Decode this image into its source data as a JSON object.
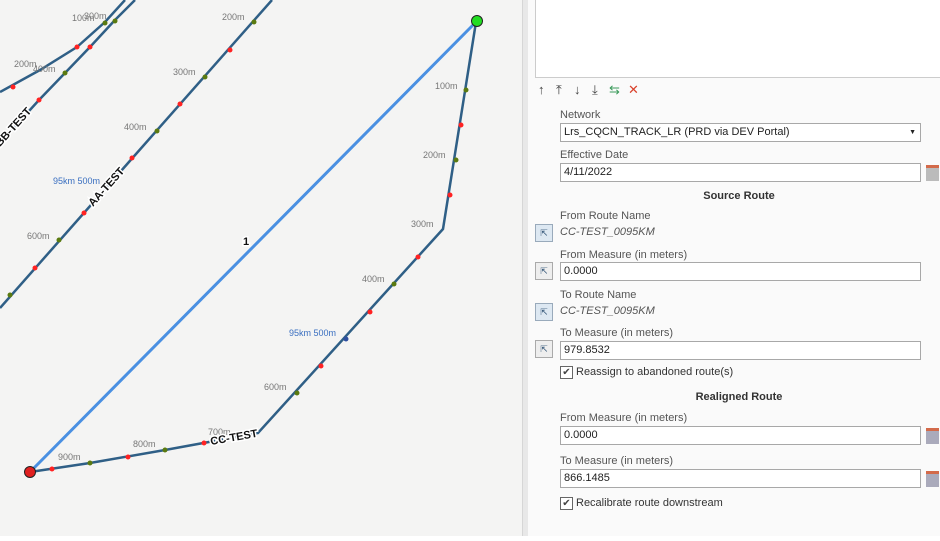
{
  "map": {
    "feature_label": "1",
    "route_labels": [
      "AA-TEST",
      "BB-TEST",
      "CC-TEST"
    ],
    "measure_labels": [
      "100m",
      "300m",
      "200m",
      "400m",
      "200m",
      "300m",
      "400m",
      "600m",
      "100m",
      "200m",
      "300m",
      "400m",
      "600m",
      "700m",
      "800m",
      "900m"
    ],
    "km_labels": [
      "95km 500m",
      "95km 500m"
    ]
  },
  "toolbar": {
    "icons": [
      "move-up-icon",
      "move-top-icon",
      "move-down-icon",
      "move-bottom-icon",
      "reverse-icon",
      "delete-icon"
    ]
  },
  "form": {
    "network_label": "Network",
    "network_value": "Lrs_CQCN_TRACK_LR (PRD via DEV Portal)",
    "effective_date_label": "Effective Date",
    "effective_date_value": "4/11/2022",
    "source_route_title": "Source Route",
    "from_route_name_label": "From Route Name",
    "from_route_name_value": "CC-TEST_0095KM",
    "from_measure_label": "From Measure (in meters)",
    "from_measure_value": "0.0000",
    "to_route_name_label": "To Route Name",
    "to_route_name_value": "CC-TEST_0095KM",
    "to_measure_label": "To Measure (in meters)",
    "to_measure_value": "979.8532",
    "reassign_label": "Reassign to abandoned route(s)",
    "reassign_checked": true,
    "realigned_route_title": "Realigned Route",
    "re_from_measure_label": "From Measure (in meters)",
    "re_from_measure_value": "0.0000",
    "re_to_measure_label": "To Measure (in meters)",
    "re_to_measure_value": "866.1485",
    "recalibrate_label": "Recalibrate route downstream",
    "recalibrate_checked": true
  },
  "colors": {
    "route": "#2f5f86",
    "realign": "#4a90e2",
    "start": "#e02020",
    "end": "#22dd22"
  }
}
